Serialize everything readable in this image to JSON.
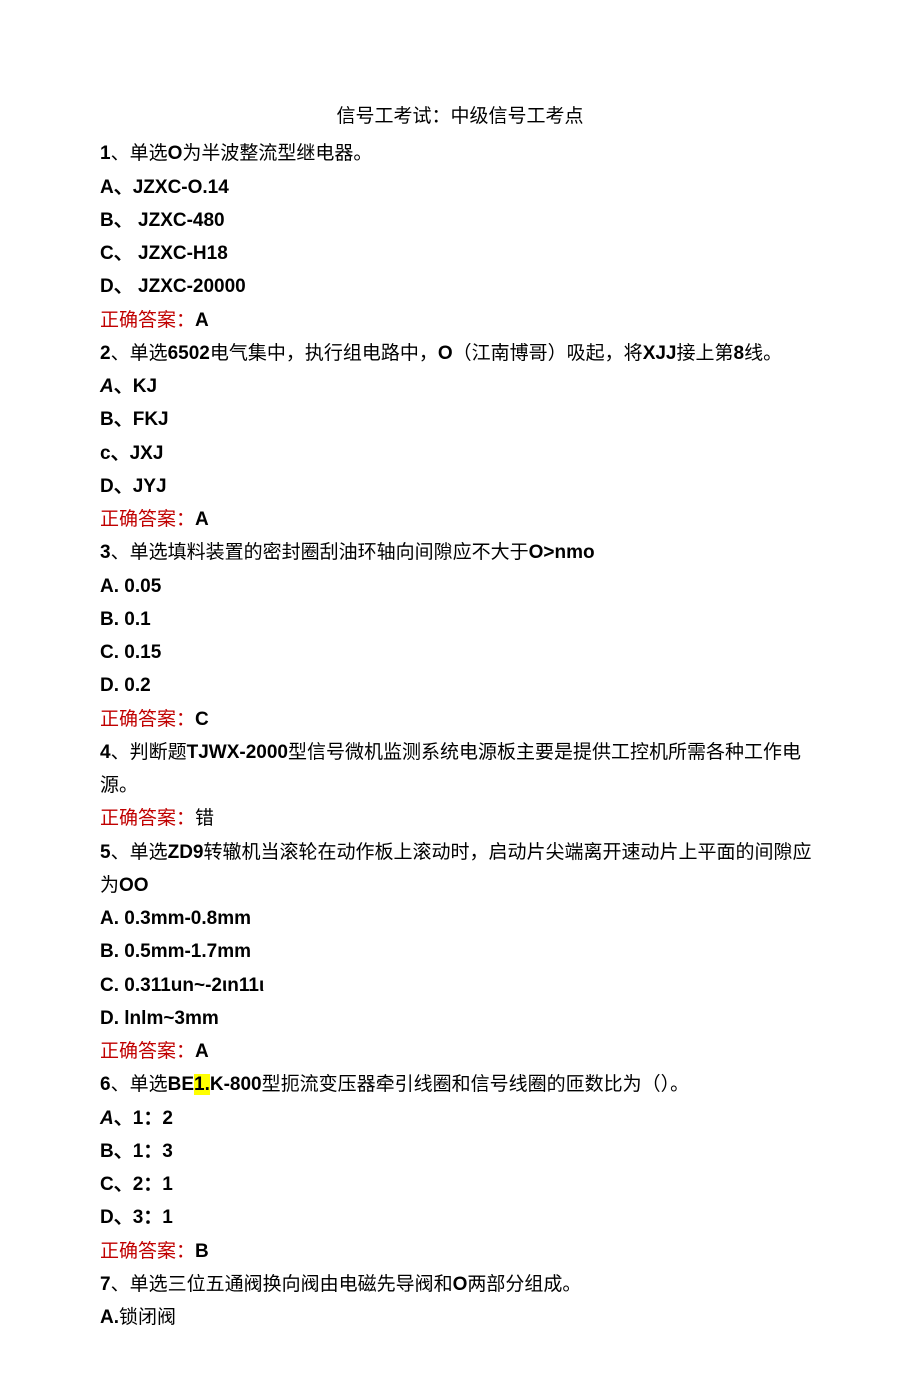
{
  "title": "信号工考试：中级信号工考点",
  "q1": {
    "stem_num": "1",
    "stem_type": "、单选",
    "stem_bold": "O",
    "stem_rest": "为半波整流型继电器。",
    "A_pre": "A、",
    "A": "JZXC-O.14",
    "B_pre": "B、 ",
    "B": "JZXC-480",
    "C_pre": "C、 ",
    "C": "JZXC-H18",
    "D_pre": "D、 ",
    "D": "JZXC-20000",
    "ans_label": "正确答案：",
    "ans": "A"
  },
  "q2": {
    "stem_num": "2",
    "stem_p1": "、单选",
    "stem_b1": "6502",
    "stem_p2": "电气集中，执行组电路中，",
    "stem_b2": "O",
    "stem_p3": "（江南博哥）吸起，将",
    "stem_b3": "XJJ",
    "stem_p4": "接上第",
    "stem_b4": "8",
    "stem_p5": "线。",
    "A_pre_italic": "A",
    "A_pre": "、",
    "A": "KJ",
    "B_pre": "B、",
    "B": "FKJ",
    "C_pre": "c、",
    "C": "JXJ",
    "D_pre": "D、",
    "D": "JYJ",
    "ans_label": "正确答案：",
    "ans": "A"
  },
  "q3": {
    "stem_num": "3",
    "stem_p1": "、单选填料装置的密封圈刮油环轴向间隙应不大于",
    "stem_b1": "O>nmo",
    "A_pre": "A.  ",
    "A": "0.05",
    "B_pre": "B.  ",
    "B": "0.1",
    "C_pre": "C.  ",
    "C": "0.15",
    "D_pre": "D.  ",
    "D": "0.2",
    "ans_label": "正确答案：",
    "ans": "C"
  },
  "q4": {
    "stem_num": "4",
    "stem_p1": "、判断题",
    "stem_b1": "TJWX-2000",
    "stem_p2": "型信号微机监测系统电源板主要是提供工控机所需各种工作电源。",
    "ans_label": "正确答案：",
    "ans": "错"
  },
  "q5": {
    "stem_num": "5",
    "stem_p1": "、单选",
    "stem_b1": "ZD9",
    "stem_p2": "转辙机当滚轮在动作板上滚动时，启动片尖端离开速动片上平面的间隙应为",
    "stem_b2": "OO",
    "A_pre": "A.  ",
    "A": "0.3mm-0.8mm",
    "B_pre": "B.  ",
    "B": "0.5mm-1.7mm",
    "C_pre": "C.  ",
    "C": "0.311un~-2ιn11ι",
    "D_pre": "D.  ",
    "D": "lnlm~3mm",
    "ans_label": "正确答案：",
    "ans": "A"
  },
  "q6": {
    "stem_num": "6",
    "stem_p1": "、单选",
    "stem_b1": "BE",
    "stem_hl": "1.",
    "stem_b2": "K-800",
    "stem_p2": "型扼流变压器牵引线圈和信号线圈的匝数比为（）。",
    "A_pre_italic": "A",
    "A_pre": "、",
    "A": "1：2",
    "B_pre": "B、",
    "B": "1：3",
    "C_pre": "C、",
    "C": "2：1",
    "D_pre": "D、",
    "D": "3：1",
    "ans_label": "正确答案：",
    "ans": "B"
  },
  "q7": {
    "stem_num": "7",
    "stem_p1": "、单选三位五通阀换向阀由电磁先导阀和",
    "stem_b1": "O",
    "stem_p2": "两部分组成。",
    "A_pre": "A.",
    "A": "锁闭阀"
  }
}
